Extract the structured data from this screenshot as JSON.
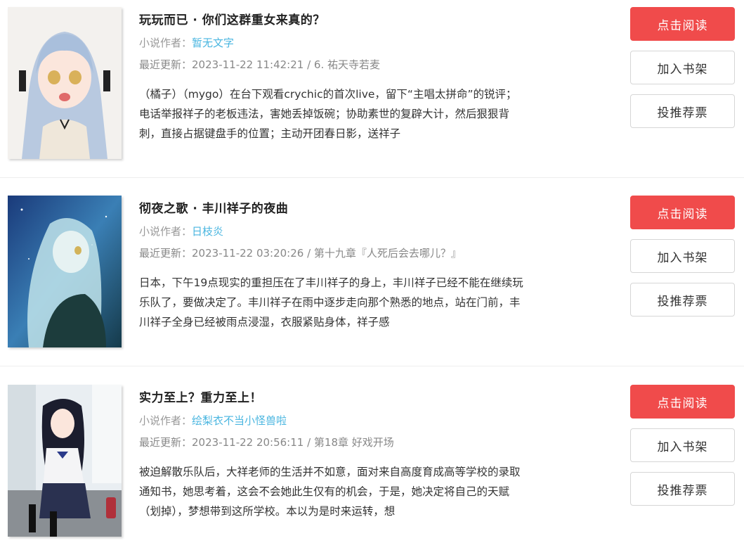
{
  "books": [
    {
      "title": "玩玩而已 · 你们这群重女来真的？",
      "author_label": "小说作者：",
      "author": "暂无文字",
      "update_label": "最近更新：",
      "update": "2023-11-22 11:42:21 / 6. 祐天寺若麦",
      "description": "（橘子）（mygo）在台下观看crychic的首次live，留下“主唱太拼命”的锐评；电话举报祥子的老板违法，害她丢掉饭碗；协助素世的复辟大计，然后狠狠背刺，直接占据键盘手的位置；主动开团春日影，送祥子",
      "read_label": "点击阅读",
      "shelf_label": "加入书架",
      "vote_label": "投推荐票"
    },
    {
      "title": "彻夜之歌 · 丰川祥子的夜曲",
      "author_label": "小说作者：",
      "author": "日枝炎",
      "update_label": "最近更新：",
      "update": "2023-11-22 03:20:26 / 第十九章『人死后会去哪儿？』",
      "description": "日本，下午19点现实的重担压在了丰川祥子的身上，丰川祥子已经不能在继续玩乐队了，要做决定了。丰川祥子在雨中逐步走向那个熟悉的地点，站在门前，丰川祥子全身已经被雨点浸湿，衣服紧贴身体，祥子感",
      "read_label": "点击阅读",
      "shelf_label": "加入书架",
      "vote_label": "投推荐票"
    },
    {
      "title": "实力至上？重力至上！",
      "author_label": "小说作者：",
      "author": "绘梨衣不当小怪兽啦",
      "update_label": "最近更新：",
      "update": "2023-11-22 20:56:11 / 第18章 好戏开场",
      "description": "被迫解散乐队后，大祥老师的生活并不如意，面对来自高度育成高等学校的录取通知书，她思考着，这会不会她此生仅有的机会，于是，她决定将自己的天赋（划掉），梦想带到这所学校。本以为是时来运转，想",
      "read_label": "点击阅读",
      "shelf_label": "加入书架",
      "vote_label": "投推荐票"
    }
  ],
  "colors": {
    "read_button": "#f04b4b",
    "author_link": "#4ab6e0",
    "meta_text": "#888888"
  }
}
